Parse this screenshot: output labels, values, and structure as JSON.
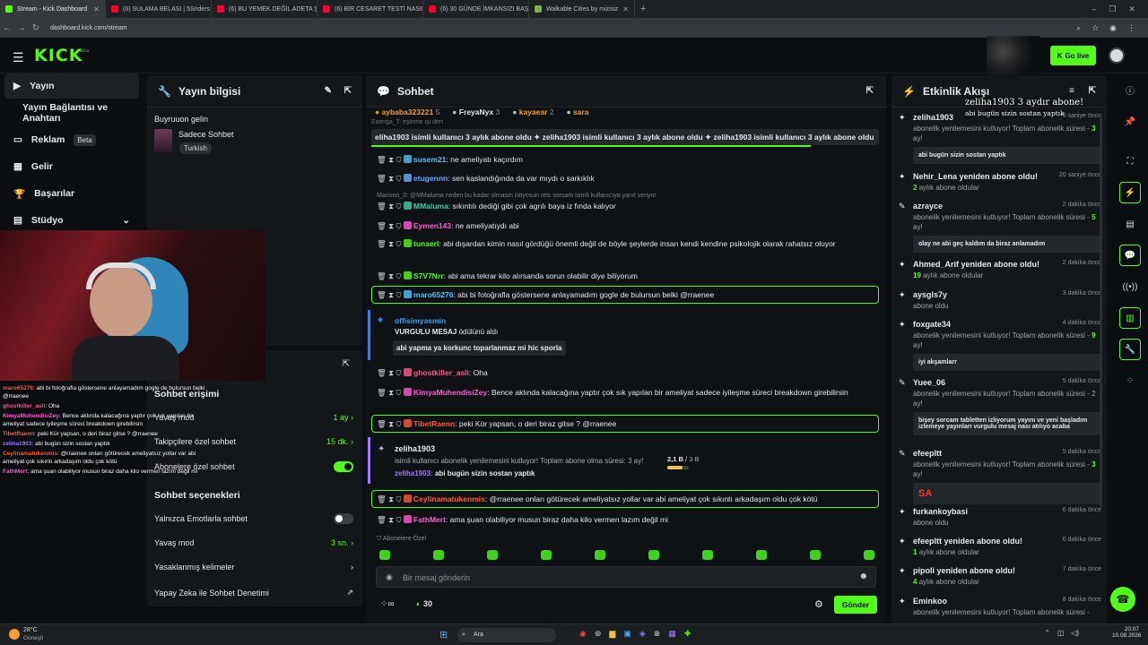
{
  "browser": {
    "tabs": [
      {
        "label": "Stream - Kick Dashboard",
        "color": "#53fc18",
        "active": true
      },
      {
        "label": "(6) SULAMA BELASI | 5Sriders",
        "color": "#ff0033",
        "active": false
      },
      {
        "label": "(6) BU YEMEK DEĞİL ADETA ŞÖ",
        "color": "#ff0033",
        "active": false
      },
      {
        "label": "(6) BİR CESARET TESTİ NASIL F",
        "color": "#ff0033",
        "active": false
      },
      {
        "label": "(6) 30 GÜNDE İMKANSIZI BAŞA",
        "color": "#ff0033",
        "active": false
      },
      {
        "label": "Walkable Cities by mizisiz",
        "color": "#7ab648",
        "active": false
      }
    ],
    "url": "dashboard.kick.com/stream"
  },
  "topbar": {
    "logo": "KICK",
    "beta": "BETA",
    "go_live": "Go live"
  },
  "sidebar": {
    "items": [
      {
        "label": "Yayın",
        "icon": "broadcast-icon"
      },
      {
        "label": "Yayın Bağlantısı ve Anahtarı",
        "icon": "key-icon"
      },
      {
        "label": "Reklam",
        "badge": "Beta",
        "icon": "ad-icon"
      },
      {
        "label": "Gelir",
        "icon": "chart-icon"
      },
      {
        "label": "Başarılar",
        "icon": "trophy-icon"
      },
      {
        "label": "Stüdyo",
        "icon": "studio-icon"
      }
    ]
  },
  "stream_info": {
    "title": "Yayın bilgisi",
    "stream_title": "Buyruuon gelin",
    "category": "Sadece Sohbet",
    "language": "Turkish"
  },
  "chat_settings": {
    "access_title": "Sohbet erişimi",
    "slow_label": "Yavaş mod",
    "slow_value_a": "1 ay",
    "followers_label": "Takipçilere özel sohbet",
    "followers_value": "15 dk.",
    "subs_label": "Abonelere özel sohbet",
    "options_title": "Sohbet seçenekleri",
    "emote_only": "Yalnızca Emotlarla sohbet",
    "slow_mode": "Yavaş mod",
    "slow_mode_value": "3 sn.",
    "banned_words": "Yasaklanmış kelimeler",
    "ai_mod": "Yapay Zeka ile Sohbet Denetimi"
  },
  "overlay_chat": [
    {
      "user": "maro65276",
      "color": "#ff5b3c",
      "text": "abi bi fotoğrafla göstersene anlayamadım gogle de bulursun belki @rraenee"
    },
    {
      "user": "ghostkiller_asli",
      "color": "#ff5b8c",
      "text": "Oha"
    },
    {
      "user": "KimyaMuhendisiZey",
      "color": "#ff5bd0",
      "text": "Bence aklında kalacağına yaptır çok sık yapılan bir ameliyat sadece iyileşme süreci breakdown girebilirsin"
    },
    {
      "user": "TibetRaenn",
      "color": "#ff5b3c",
      "text": "peki Kür yapsan, o deri biraz gitse ? @rraenee"
    },
    {
      "user": "zeliha1903",
      "color": "#9e7bff",
      "text": "abi bugün sizin sostan yaptık"
    },
    {
      "user": "Ceylinamatukenmis",
      "color": "#ff5b3c",
      "text": "@rraenee onları götürecek ameliyatsız yollar var abi ameliyat çok sıkıntı arkadaşım oldu çok kötü"
    },
    {
      "user": "FathMert",
      "color": "#ff5bd0",
      "text": "ama şuan olabiliyor musun biraz daha kilo vermen lazım değil mi"
    }
  ],
  "chat": {
    "title": "Sohbet",
    "top_gifters": [
      {
        "name": "aybaba323221",
        "count": "5"
      },
      {
        "name": "FreyaNyx",
        "count": "3"
      },
      {
        "name": "kayaear",
        "count": "2"
      },
      {
        "name": "sara",
        "count": ""
      }
    ],
    "ticker": "eliha1903 isimli kullanıcı 3 aylık abone oldu  ✦ zeliha1903 isimli kullanıcı 3 aylık abone oldu  ✦ zeliha1903 isimli kullanıcı 3 aylık abone oldu",
    "ticker_top": "Eseriga_T: eşlirme işi dert",
    "messages": [
      {
        "user": "susem21",
        "color": "#4fc3ff",
        "text": "ne ameliyatı kaçırdım"
      },
      {
        "user": "etugennn",
        "color": "#6fa8ff",
        "text": "sen kaslandığında da var mıydı o sarkıklık"
      },
      {
        "user": "MMaluma",
        "color": "#3fd0a6",
        "text": "sıkıntılı dediği gibi çok agrılı baya iz fında kalıyor",
        "reply": "Marionn_0: @MMaluma neden bu kadar olmasın istiyosun reis sorsam isimli kullanıcıya yanıt veriyor"
      },
      {
        "user": "Eymen143",
        "color": "#ff5bd0",
        "text": "ne ameliyatıydı abi"
      },
      {
        "user": "tunaerl",
        "color": "#53fc18",
        "text": "abi dışardan kimin nasıl gördüğü önemli değil de böyle şeylerde insan kendi kendine psikolojik olarak rahatsız oluyor"
      },
      {
        "user": "S7V7Nrr",
        "color": "#53fc18",
        "text": "abi ama tekrar kilo alırsanda sorun olabilir diye biliyorum"
      },
      {
        "user": "maro65276",
        "color": "#4fc3ff",
        "text": "abi bi fotoğrafla göstersene anlayamadım gogle de bulursun belki @rraenee"
      },
      {
        "user": "ghostkiller_asli",
        "color": "#ff5b8c",
        "text": "Oha"
      },
      {
        "user": "KimyaMuhendisiZey",
        "color": "#ff5bd0",
        "text": "Bence aklında kalacağına yaptır çok sık yapılan bir ameliyat sadece iyileşme süreci breakdown girebilirsin"
      },
      {
        "user": "TibetRaenn",
        "color": "#ff5b3c",
        "text": "peki Kür yapsan, o deri biraz gitse ? @rraenee"
      },
      {
        "user": "Ceylinamatukenmis",
        "color": "#ff5b3c",
        "text": "@rraenee onları götürecek ameliyatsız yollar var abi ameliyat çok sıkıntı arkadaşım oldu çok kötü"
      },
      {
        "user": "FathMert",
        "color": "#ff5bd0",
        "text": "ama şuan olabiliyor musun biraz daha kilo vermen lazım değil mi"
      }
    ],
    "highlight": {
      "user": "offisimyasmin",
      "label": "VURGULU MESAJ",
      "label2": "ödülünü aldı",
      "text": "abi yapma ya korkunc toparlanmaz mi hic sporla"
    },
    "sub_card": {
      "user": "zeliha1903",
      "text": "isimli kullanıcı abonelik yenilemesini kutluyor! Toplam abone olma süresi: 3 ay!",
      "msg_user": "zeliha1903:",
      "msg": "abi bugün sizin sostan yaptık",
      "progress": "2,1 B",
      "goal": "3 B",
      "progress_fraction": 0.7
    },
    "subs_label": "Abonelere Özel",
    "input_placeholder": "Bir mesaj gönderin",
    "points": "30",
    "send": "Gönder"
  },
  "events": {
    "title": "Etkinlik Akışı",
    "overlay": "zeliha1903 3 aydır abone!",
    "overlay_sub": "abi bugün sizin sostan yaptık",
    "items": [
      {
        "name": "zeliha1903",
        "time": "5 saniye önce",
        "sub": "abonelik yenilemesini kutluyor! Toplam abonelik süresi -",
        "months": "3",
        "months_label": "ay!",
        "box": "abi bugün sizin sostan yaptık"
      },
      {
        "name": "Nehir_Lena yeniden abone oldu!",
        "time": "20 saniye önce",
        "months": "2",
        "months_label": "aylık abone oldular"
      },
      {
        "name": "azrayce",
        "time": "2 dakika önce",
        "sub": "abonelik yenilemesini kutluyor! Toplam abonelik süresi -",
        "months": "5",
        "months_label": "ay!",
        "box": "olay ne abi geç kaldım da biraz anlamadım"
      },
      {
        "name": "Ahmed_Arif yeniden abone oldu!",
        "time": "2 dakika önce",
        "months": "19",
        "months_label": "aylık abone oldular"
      },
      {
        "name": "aysgls7y",
        "time": "3 dakika önce",
        "sub": "abone oldu"
      },
      {
        "name": "foxgate34",
        "time": "4 dakika önce",
        "sub": "abonelik yenilemesini kutluyor! Toplam abonelik süresi -",
        "months": "9",
        "months_label": "ay!",
        "box": "iyi akşamlarr"
      },
      {
        "name": "Yuee_06",
        "time": "5 dakika önce",
        "sub": "abonelik yenilemesini kutluyor! Toplam abonelik süresi - 2 ay!",
        "box": "bişey sorcam tabletten izliyorum yayını ve yeni başladım izlemeye yayınları vurgulu mesaj nası atılıyo acaba"
      },
      {
        "name": "efeepltt",
        "time": "5 dakika önce",
        "sub": "abonelik yenilemesini kutluyor! Toplam abonelik süresi -",
        "months": "3",
        "months_label": "ay!",
        "box": "SA"
      },
      {
        "name": "furkankoybasi",
        "time": "6 dakika önce",
        "sub": "abone oldu"
      },
      {
        "name": "efeepltt yeniden abone oldu!",
        "time": "6 dakika önce",
        "months": "1",
        "months_label": "aylık abone oldular"
      },
      {
        "name": "pipoli yeniden abone oldu!",
        "time": "7 dakika önce",
        "months": "4",
        "months_label": "aylık abone oldular"
      },
      {
        "name": "Eminkoo",
        "time": "8 dakika önce",
        "sub": "abonelik yenilemesini kutluyor! Toplam abonelik süresi -"
      }
    ]
  },
  "taskbar": {
    "weather_temp": "28°C",
    "weather_desc": "Güneşli",
    "search": "Ara",
    "time": "20:07",
    "date": "10.08.2026"
  },
  "colors": {
    "accent": "#53fc18",
    "panel": "#14171a",
    "bg": "#0b0e10"
  }
}
